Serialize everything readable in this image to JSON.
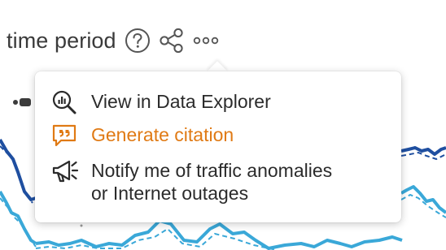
{
  "header": {
    "title": "time period",
    "help_icon": "help-circle-icon",
    "share_icon": "share-icon",
    "more_icon": "more-horizontal-icon"
  },
  "menu": {
    "items": [
      {
        "label": "View in Data Explorer",
        "icon": "data-explorer-icon"
      },
      {
        "label": "Generate citation",
        "icon": "citation-icon",
        "color": "#e07a14"
      },
      {
        "label": "Notify me of traffic anomalies\nor Internet outages",
        "icon": "megaphone-icon"
      }
    ]
  },
  "colors": {
    "dark_series": "#1f4fa0",
    "light_series": "#3aa8d8",
    "accent": "#e07a14"
  }
}
